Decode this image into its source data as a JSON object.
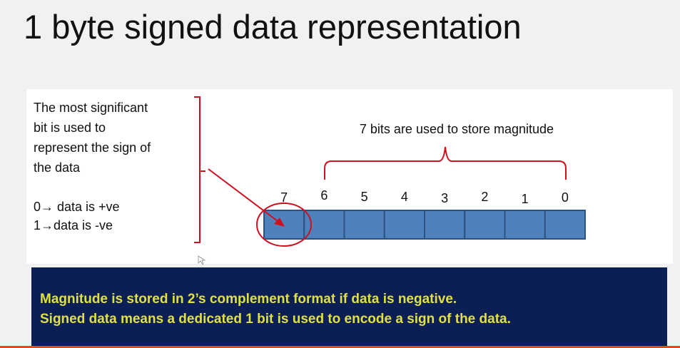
{
  "title": "1 byte signed data representation",
  "side_text": {
    "lines": [
      "The most significant",
      "bit is used to",
      "represent the sign of",
      "the data"
    ],
    "sign_rules": [
      "0→ data is +ve",
      "1→data is -ve"
    ]
  },
  "diagram": {
    "magnitude_label": "7 bits are used to store magnitude",
    "bit_labels": [
      "7",
      "6",
      "5",
      "4",
      "3",
      "2",
      "1",
      "0"
    ],
    "cell_color": "#4f81bd",
    "annotation_color": "#d0101f"
  },
  "note": {
    "lines": [
      "Magnitude is stored in 2’s complement format if data is negative.",
      "Signed data means a dedicated 1 bit is used to encode a sign of the data."
    ],
    "background": "#0c1f55",
    "text_color": "#e0e040"
  }
}
